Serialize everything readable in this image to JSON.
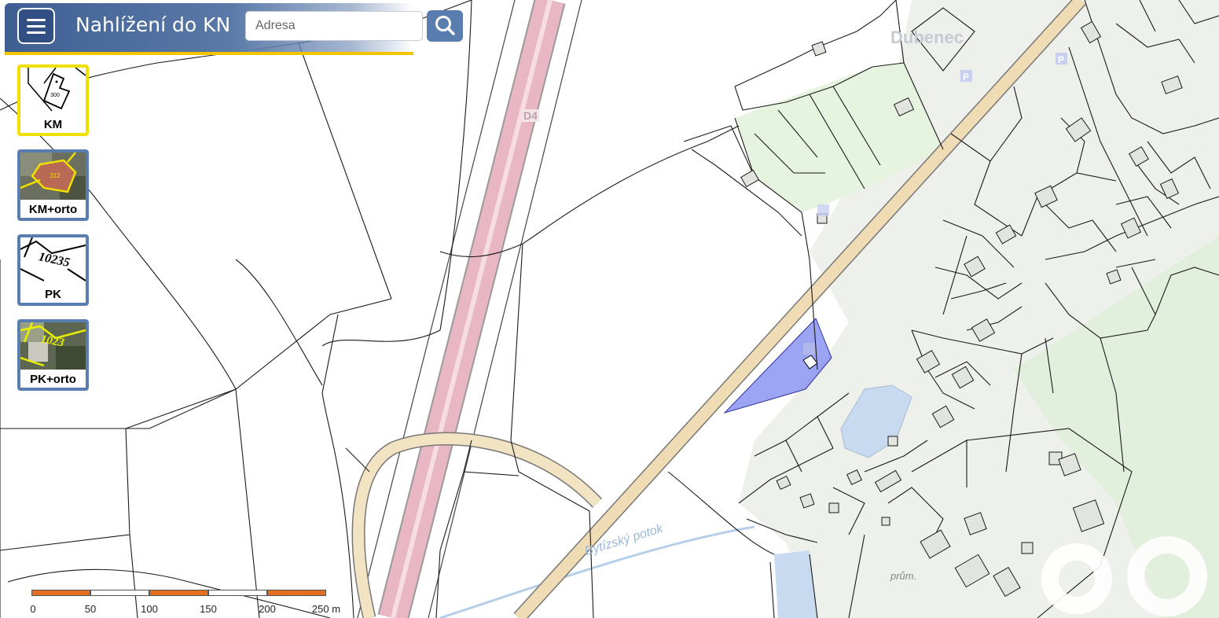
{
  "header": {
    "app_title": "Nahlížení do KN",
    "menu_icon": "hamburger-icon",
    "search": {
      "placeholder": "Adresa",
      "value": "",
      "button_icon": "search-icon"
    }
  },
  "layers": [
    {
      "label": "KM",
      "active": true
    },
    {
      "label": "KM+orto",
      "active": false
    },
    {
      "label": "PK",
      "active": false
    },
    {
      "label": "PK+orto",
      "active": false
    }
  ],
  "thumbnails": {
    "km_parcel_number": "300",
    "km_orto_parcel_number": "312",
    "pk_number": "10235",
    "pk_orto_number": "1023"
  },
  "map": {
    "labels": {
      "town": "Dubenec",
      "road": "D4",
      "stream": "Bytízský potok",
      "industrial": "prům."
    },
    "colors": {
      "background": "#ffffff",
      "selected_parcel": "#7b87f0",
      "highway": "#e8b7c3",
      "main_road": "#f0dcb4",
      "water": "#c8daf0",
      "green_area": "#e6f3df",
      "built_up_area": "#eef0eb"
    }
  },
  "scale_bar": {
    "ticks": [
      "0",
      "50",
      "100",
      "150",
      "200",
      "250 m"
    ],
    "colors": [
      "#e46e1e",
      "#ffffff"
    ]
  },
  "watermark": "edo"
}
